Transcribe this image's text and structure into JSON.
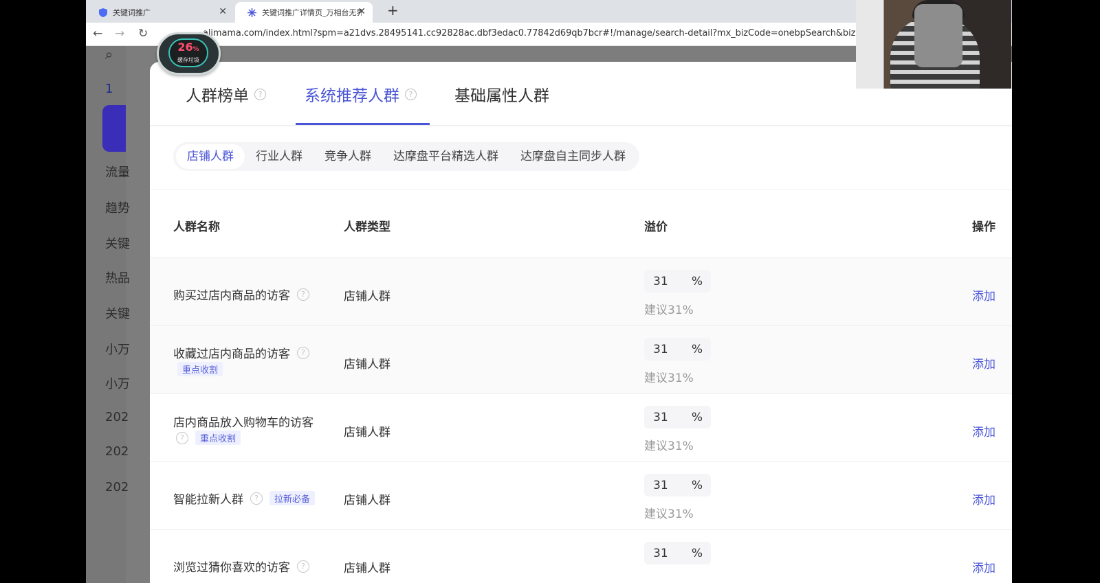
{
  "browser": {
    "tabs": [
      {
        "label": "关键词推广",
        "active": false
      },
      {
        "label": "关键词推广详情页_万相台无界",
        "active": true
      }
    ],
    "url": "alimama.com/index.html?spm=a21dvs.28495141.cc92828ac.dbf3edac0.77842d69qb7bcr#!/manage/search-detail?mx_bizCode=onebpSearch&bizCode="
  },
  "badge": {
    "percent": "26",
    "unit": "%",
    "label": "缓存垃圾"
  },
  "sidebar": {
    "items": [
      "1",
      "流量",
      "趋势",
      "关键",
      "热品",
      "关键",
      "小万",
      "小万",
      "202",
      "202",
      "202"
    ]
  },
  "main_tabs": [
    {
      "label": "人群榜单",
      "active": false
    },
    {
      "label": "系统推荐人群",
      "active": true
    },
    {
      "label": "基础属性人群",
      "active": false
    }
  ],
  "sub_tabs": [
    {
      "label": "店铺人群",
      "active": true
    },
    {
      "label": "行业人群",
      "active": false
    },
    {
      "label": "竞争人群",
      "active": false
    },
    {
      "label": "达摩盘平台精选人群",
      "active": false
    },
    {
      "label": "达摩盘自主同步人群",
      "active": false
    }
  ],
  "table": {
    "headers": {
      "name": "人群名称",
      "type": "人群类型",
      "premium": "溢价",
      "action": "操作"
    },
    "rows": [
      {
        "name": "购买过店内商品的访客",
        "tag": "",
        "type": "店铺人群",
        "value": "31",
        "unit": "%",
        "suggest": "建议31%",
        "action": "添加"
      },
      {
        "name": "收藏过店内商品的访客",
        "tag": "重点收割",
        "type": "店铺人群",
        "value": "31",
        "unit": "%",
        "suggest": "建议31%",
        "action": "添加"
      },
      {
        "name": "店内商品放入购物车的访客",
        "tag": "重点收割",
        "type": "店铺人群",
        "value": "31",
        "unit": "%",
        "suggest": "建议31%",
        "action": "添加"
      },
      {
        "name": "智能拉新人群",
        "tag": "拉新必备",
        "type": "店铺人群",
        "value": "31",
        "unit": "%",
        "suggest": "建议31%",
        "action": "添加"
      },
      {
        "name": "浏览过猜你喜欢的访客",
        "tag": "",
        "type": "店铺人群",
        "value": "31",
        "unit": "%",
        "suggest": "",
        "action": "添加"
      }
    ]
  },
  "colors": {
    "accent": "#4a55d6",
    "tag_bg": "#eef0ff",
    "sidebar_active": "#3a2db8"
  }
}
